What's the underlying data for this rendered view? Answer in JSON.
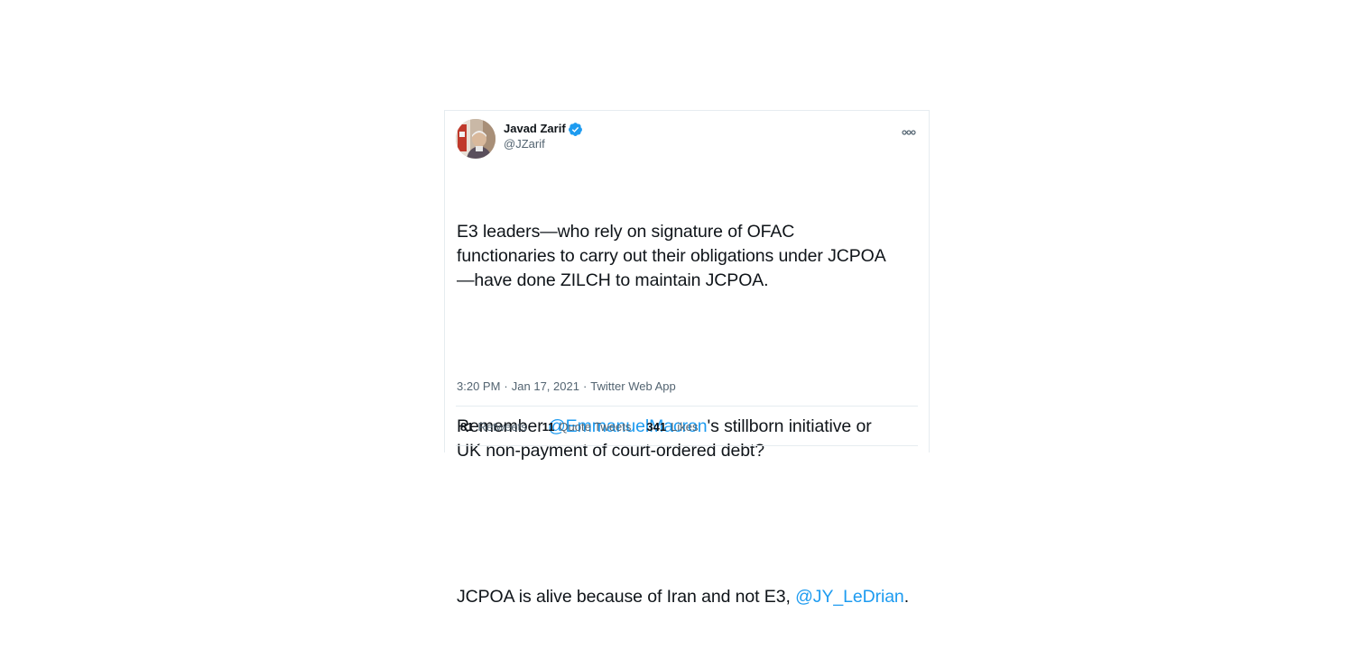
{
  "author": {
    "display_name": "Javad Zarif",
    "handle": "@JZarif",
    "verified": true,
    "avatar": "profile-photo"
  },
  "tweet": {
    "paragraph1": "E3 leaders—who rely on signature of OFAC functionaries to carry out their obligations under JCPOA —have done ZILCH to maintain JCPOA.",
    "line1": "E3 leaders—who rely on signature of OFAC",
    "line2": "functionaries to carry out their obligations under JCPOA",
    "line3": "—have done ZILCH to maintain JCPOA.",
    "p2_prefix": "Remember ",
    "p2_mention": "@EmmanuelMacron",
    "p2_suffix_line1": "'s stillborn initiative or",
    "p2_line2": "UK non-payment of court-ordered debt?",
    "p3_prefix": "JCPOA is alive because of Iran and not E3, ",
    "p3_mention": "@JY_LeDrian",
    "p3_suffix": "."
  },
  "meta": {
    "time": "3:20 PM",
    "separator": "·",
    "date": "Jan 17, 2021",
    "source": "Twitter Web App"
  },
  "stats": {
    "retweets_count": "81",
    "retweets_label": "Retweets",
    "quotes_count": "11",
    "quotes_label": "Quote Tweets",
    "likes_count": "341",
    "likes_label": "Likes"
  },
  "colors": {
    "link": "#1d9bf0",
    "verified": "#1d9bf0",
    "secondary_text": "#536471",
    "divider": "#e6ecf0"
  },
  "icons": {
    "verified": "verified-badge-icon",
    "more": "more-options-icon"
  }
}
